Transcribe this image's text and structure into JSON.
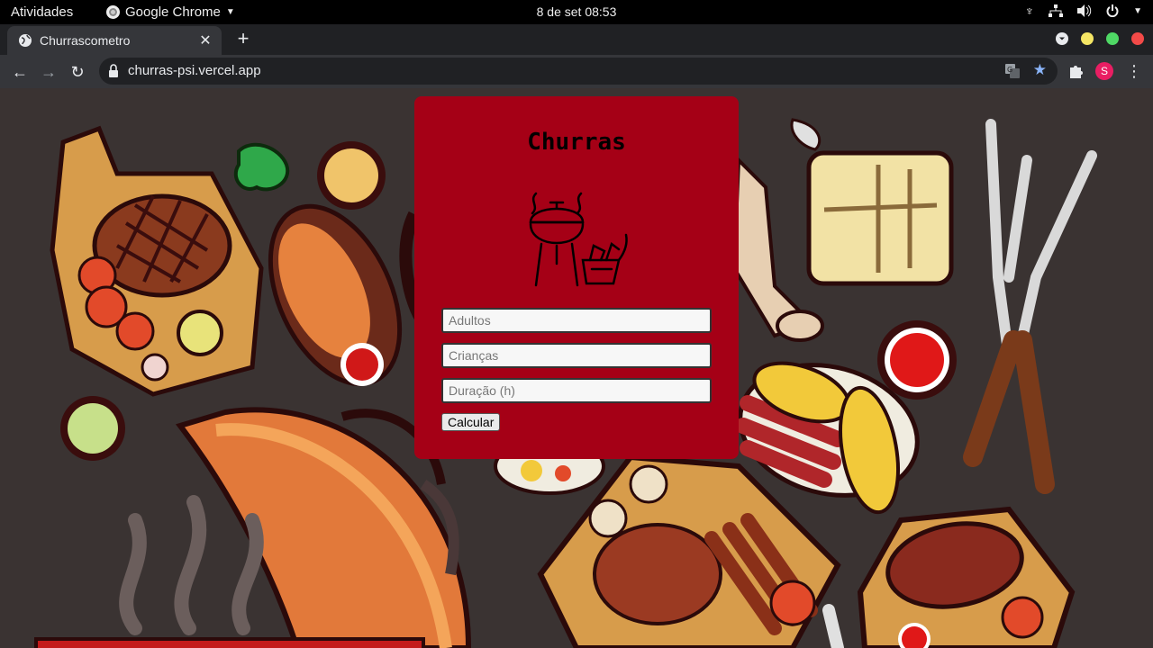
{
  "system_bar": {
    "activities": "Atividades",
    "app_name": "Google Chrome",
    "datetime": "8 de set  08:53"
  },
  "browser": {
    "tab_title": "Churrascometro",
    "url": "churras-psi.vercel.app",
    "profile_initial": "S",
    "window_colors": {
      "minimize": "#f5e665",
      "maximize": "#4fd865",
      "close": "#f24a48"
    }
  },
  "form": {
    "title": "Churras",
    "adults_placeholder": "Adultos",
    "children_placeholder": "Crianças",
    "duration_placeholder": "Duração (h)",
    "calculate_label": "Calcular",
    "card_color": "#a50016"
  },
  "icons": [
    "chrome-icon",
    "globe-favicon-icon",
    "lock-icon",
    "translate-icon",
    "star-icon",
    "puzzle-icon",
    "barbecue-grill-icon",
    "wifi-icon",
    "volume-icon",
    "power-icon"
  ]
}
